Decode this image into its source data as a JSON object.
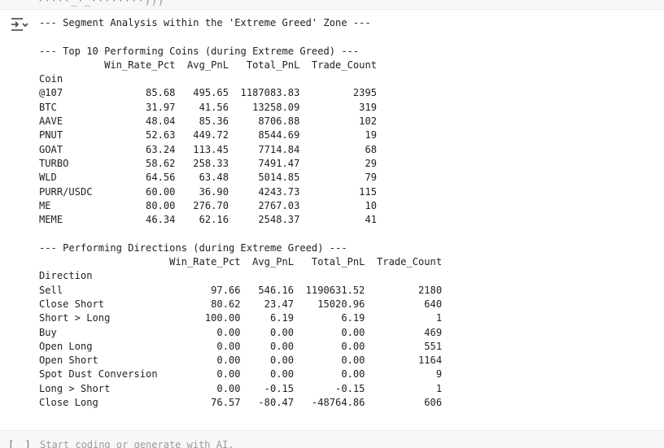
{
  "top_cell": {
    "cut_text": "·····_·_········)))"
  },
  "output": {
    "header": "--- Segment Analysis within the 'Extreme Greed' Zone ---",
    "coins_section_title": "--- Top 10 Performing Coins (during Extreme Greed) ---",
    "coins_table": {
      "columns": [
        "Win_Rate_Pct",
        "Avg_PnL",
        "Total_PnL",
        "Trade_Count"
      ],
      "index_name": "Coin",
      "rows": [
        [
          "@107",
          "85.68",
          "495.65",
          "1187083.83",
          "2395"
        ],
        [
          "BTC",
          "31.97",
          "41.56",
          "13258.09",
          "319"
        ],
        [
          "AAVE",
          "48.04",
          "85.36",
          "8706.88",
          "102"
        ],
        [
          "PNUT",
          "52.63",
          "449.72",
          "8544.69",
          "19"
        ],
        [
          "GOAT",
          "63.24",
          "113.45",
          "7714.84",
          "68"
        ],
        [
          "TURBO",
          "58.62",
          "258.33",
          "7491.47",
          "29"
        ],
        [
          "WLD",
          "64.56",
          "63.48",
          "5014.85",
          "79"
        ],
        [
          "PURR/USDC",
          "60.00",
          "36.90",
          "4243.73",
          "115"
        ],
        [
          "ME",
          "80.00",
          "276.70",
          "2767.03",
          "10"
        ],
        [
          "MEME",
          "46.34",
          "62.16",
          "2548.37",
          "41"
        ]
      ]
    },
    "directions_section_title": "--- Performing Directions (during Extreme Greed) ---",
    "directions_table": {
      "columns": [
        "Win_Rate_Pct",
        "Avg_PnL",
        "Total_PnL",
        "Trade_Count"
      ],
      "index_name": "Direction",
      "rows": [
        [
          "Sell",
          "97.66",
          "546.16",
          "1190631.52",
          "2180"
        ],
        [
          "Close Short",
          "80.62",
          "23.47",
          "15020.96",
          "640"
        ],
        [
          "Short > Long",
          "100.00",
          "6.19",
          "6.19",
          "1"
        ],
        [
          "Buy",
          "0.00",
          "0.00",
          "0.00",
          "469"
        ],
        [
          "Open Long",
          "0.00",
          "0.00",
          "0.00",
          "551"
        ],
        [
          "Open Short",
          "0.00",
          "0.00",
          "0.00",
          "1164"
        ],
        [
          "Spot Dust Conversion",
          "0.00",
          "0.00",
          "0.00",
          "9"
        ],
        [
          "Long > Short",
          "0.00",
          "-0.15",
          "-0.15",
          "1"
        ],
        [
          "Close Long",
          "76.57",
          "-80.47",
          "-48764.86",
          "606"
        ]
      ]
    }
  },
  "empty_cell": {
    "brackets": "[ ]",
    "placeholder": "Start coding or generate with AI."
  }
}
